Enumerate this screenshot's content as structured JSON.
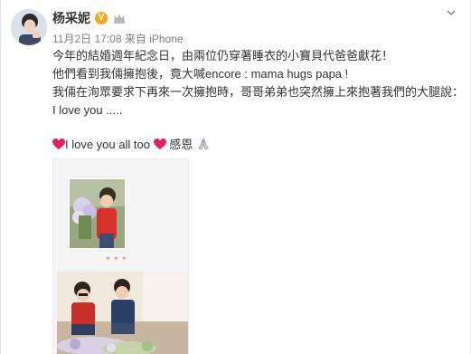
{
  "post": {
    "author": "杨采妮",
    "verified_badge": "V",
    "timestamp": "11月2日 17:08",
    "source_prefix": "来自",
    "source": "iPhone",
    "lines": [
      "今年的結婚週年紀念日，由兩位仍穿著睡衣的小寶貝代爸爸獻花！",
      "他們看到我倆擁抱後，竟大喊encore : mama hugs papa !",
      "我倆在洵眾要求下再來一次擁抱時，哥哥弟弟也突然擁上來抱著我們的大腿說：",
      "I love you .....",
      "",
      "I love you all too",
      "感恩"
    ],
    "love_line": "I love you all too",
    "thanks_word": "感恩"
  },
  "icons": {
    "verified": "verified-v-icon",
    "crown": "crown-icon",
    "chevron": "chevron-down-icon",
    "heart": "red-heart-icon",
    "pray": "pray-hands-icon"
  },
  "colors": {
    "verified": "#f5a623",
    "heart": "#e0245e",
    "meta_text": "#808080"
  }
}
